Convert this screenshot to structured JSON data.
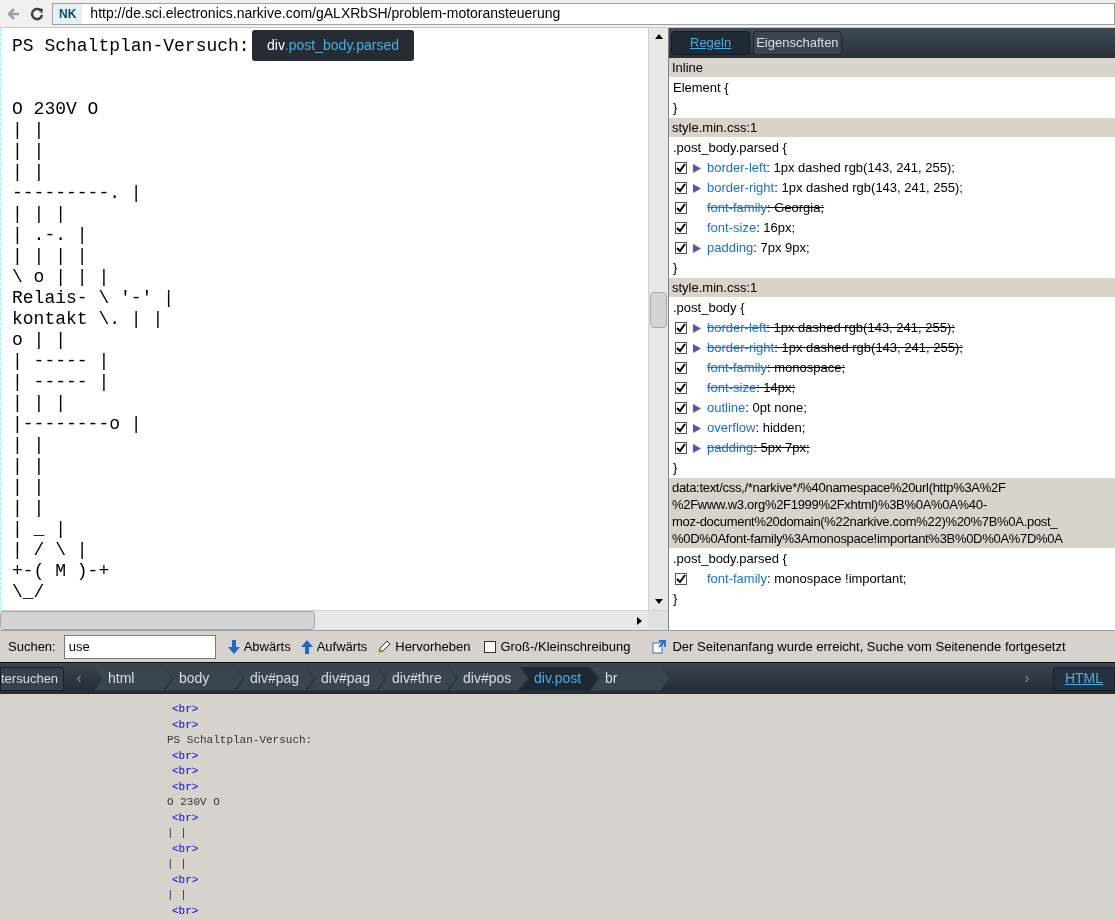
{
  "toolbar": {
    "site_badge": "NK",
    "url": "http://de.sci.electronics.narkive.com/gALXRbSH/problem-motoransteuerung"
  },
  "page": {
    "heading": "PS Schaltplan-Versuch:",
    "diagram_lines": [
      "O 230V O",
      "| |",
      "| |",
      "| |",
      "---------. |",
      "| | |",
      "| .-. |",
      "| | | |",
      "\\ o | | |",
      "Relais- \\ '-' |",
      "kontakt \\. | |",
      "o | |",
      "| ----- |",
      "| ----- |",
      "| | |",
      "|--------o |",
      "| |",
      "| |",
      "| |",
      "| |",
      "| _ |",
      "| / \\ |",
      "+-( M )-+",
      "\\_/"
    ],
    "tooltip": {
      "tag": "div",
      "classes": ".post_body.parsed"
    }
  },
  "rules_panel": {
    "tabs": [
      {
        "label": "Regeln",
        "selected": true
      },
      {
        "label": "Eigenschaften",
        "selected": false
      }
    ],
    "sections": [
      {
        "source_lines": [
          "Inline"
        ],
        "selector": "Element {",
        "close": "}"
      },
      {
        "source_lines": [
          "style.min.css:1"
        ],
        "selector": ".post_body.parsed {",
        "close": "}",
        "properties": [
          {
            "checked": true,
            "expandable": true,
            "overridden": false,
            "name": "border-left",
            "value": ": 1px dashed rgb(143, 241, 255);"
          },
          {
            "checked": true,
            "expandable": true,
            "overridden": false,
            "name": "border-right",
            "value": ": 1px dashed rgb(143, 241, 255);"
          },
          {
            "checked": true,
            "expandable": false,
            "overridden": true,
            "name": "font-family",
            "value": ": Georgia;"
          },
          {
            "checked": true,
            "expandable": false,
            "overridden": false,
            "name": "font-size",
            "value": ": 16px;"
          },
          {
            "checked": true,
            "expandable": true,
            "overridden": false,
            "name": "padding",
            "value": ": 7px 9px;"
          }
        ]
      },
      {
        "source_lines": [
          "style.min.css:1"
        ],
        "selector": ".post_body {",
        "close": "}",
        "properties": [
          {
            "checked": true,
            "expandable": true,
            "overridden": true,
            "name": "border-left",
            "value": ": 1px dashed rgb(143, 241, 255);"
          },
          {
            "checked": true,
            "expandable": true,
            "overridden": true,
            "name": "border-right",
            "value": ": 1px dashed rgb(143, 241, 255);"
          },
          {
            "checked": true,
            "expandable": false,
            "overridden": true,
            "name": "font-family",
            "value": ": monospace;"
          },
          {
            "checked": true,
            "expandable": false,
            "overridden": true,
            "name": "font-size",
            "value": ": 14px;"
          },
          {
            "checked": true,
            "expandable": true,
            "overridden": false,
            "name": "outline",
            "value": ": 0pt none;"
          },
          {
            "checked": true,
            "expandable": true,
            "overridden": false,
            "name": "overflow",
            "value": ": hidden;"
          },
          {
            "checked": true,
            "expandable": true,
            "overridden": true,
            "name": "padding",
            "value": ": 5px 7px;"
          }
        ]
      },
      {
        "source_lines": [
          "data:text/css,/*narkive*/%40namespace%20url(http%3A%2F",
          "%2Fwww.w3.org%2F1999%2Fxhtml)%3B%0A%0A%40-",
          "moz-document%20domain(%22narkive.com%22)%20%7B%0A.post_",
          "%0D%0Afont-family%3Amonospace!important%3B%0D%0A%7D%0A"
        ],
        "selector": ".post_body.parsed {",
        "close": "}",
        "properties": [
          {
            "checked": true,
            "expandable": false,
            "overridden": false,
            "name": "font-family",
            "value": ": monospace !important;"
          }
        ]
      }
    ]
  },
  "find_bar": {
    "label": "Suchen:",
    "query": "use",
    "buttons": [
      {
        "kind": "down",
        "label": "Abwärts"
      },
      {
        "kind": "up",
        "label": "Aufwärts"
      },
      {
        "kind": "highlight",
        "label": "Hervorheben"
      }
    ],
    "match_case": {
      "label": "Groß-/Kleinschreibung",
      "checked": false
    },
    "message": "Der Seitenanfang wurde erreicht, Suche vom Seitenende fortgesetzt"
  },
  "breadcrumbs": {
    "left_button": "tersuchen",
    "left_arrow": "‹",
    "items": [
      {
        "label": "html",
        "selected": false
      },
      {
        "label": "body",
        "selected": false
      },
      {
        "label": "div#pag",
        "selected": false
      },
      {
        "label": "div#pag",
        "selected": false
      },
      {
        "label": "div#thre",
        "selected": false
      },
      {
        "label": "div#pos",
        "selected": false
      },
      {
        "label": "div.post",
        "selected": true
      },
      {
        "label": "br",
        "selected": false
      }
    ],
    "right_arrow": "›",
    "view_button": "HTML"
  },
  "html_panel": {
    "nodes": [
      {
        "kind": "tag",
        "text": "<br>"
      },
      {
        "kind": "tag",
        "text": "<br>"
      },
      {
        "kind": "text",
        "text": "PS Schaltplan-Versuch:"
      },
      {
        "kind": "tag",
        "text": "<br>"
      },
      {
        "kind": "tag",
        "text": "<br>"
      },
      {
        "kind": "tag",
        "text": "<br>"
      },
      {
        "kind": "text",
        "text": "O 230V O"
      },
      {
        "kind": "tag",
        "text": "<br>"
      },
      {
        "kind": "text",
        "text": "| |"
      },
      {
        "kind": "tag",
        "text": "<br>"
      },
      {
        "kind": "text",
        "text": "| |"
      },
      {
        "kind": "tag",
        "text": "<br>"
      },
      {
        "kind": "text",
        "text": "| |"
      },
      {
        "kind": "tag",
        "text": "<br>"
      }
    ]
  }
}
